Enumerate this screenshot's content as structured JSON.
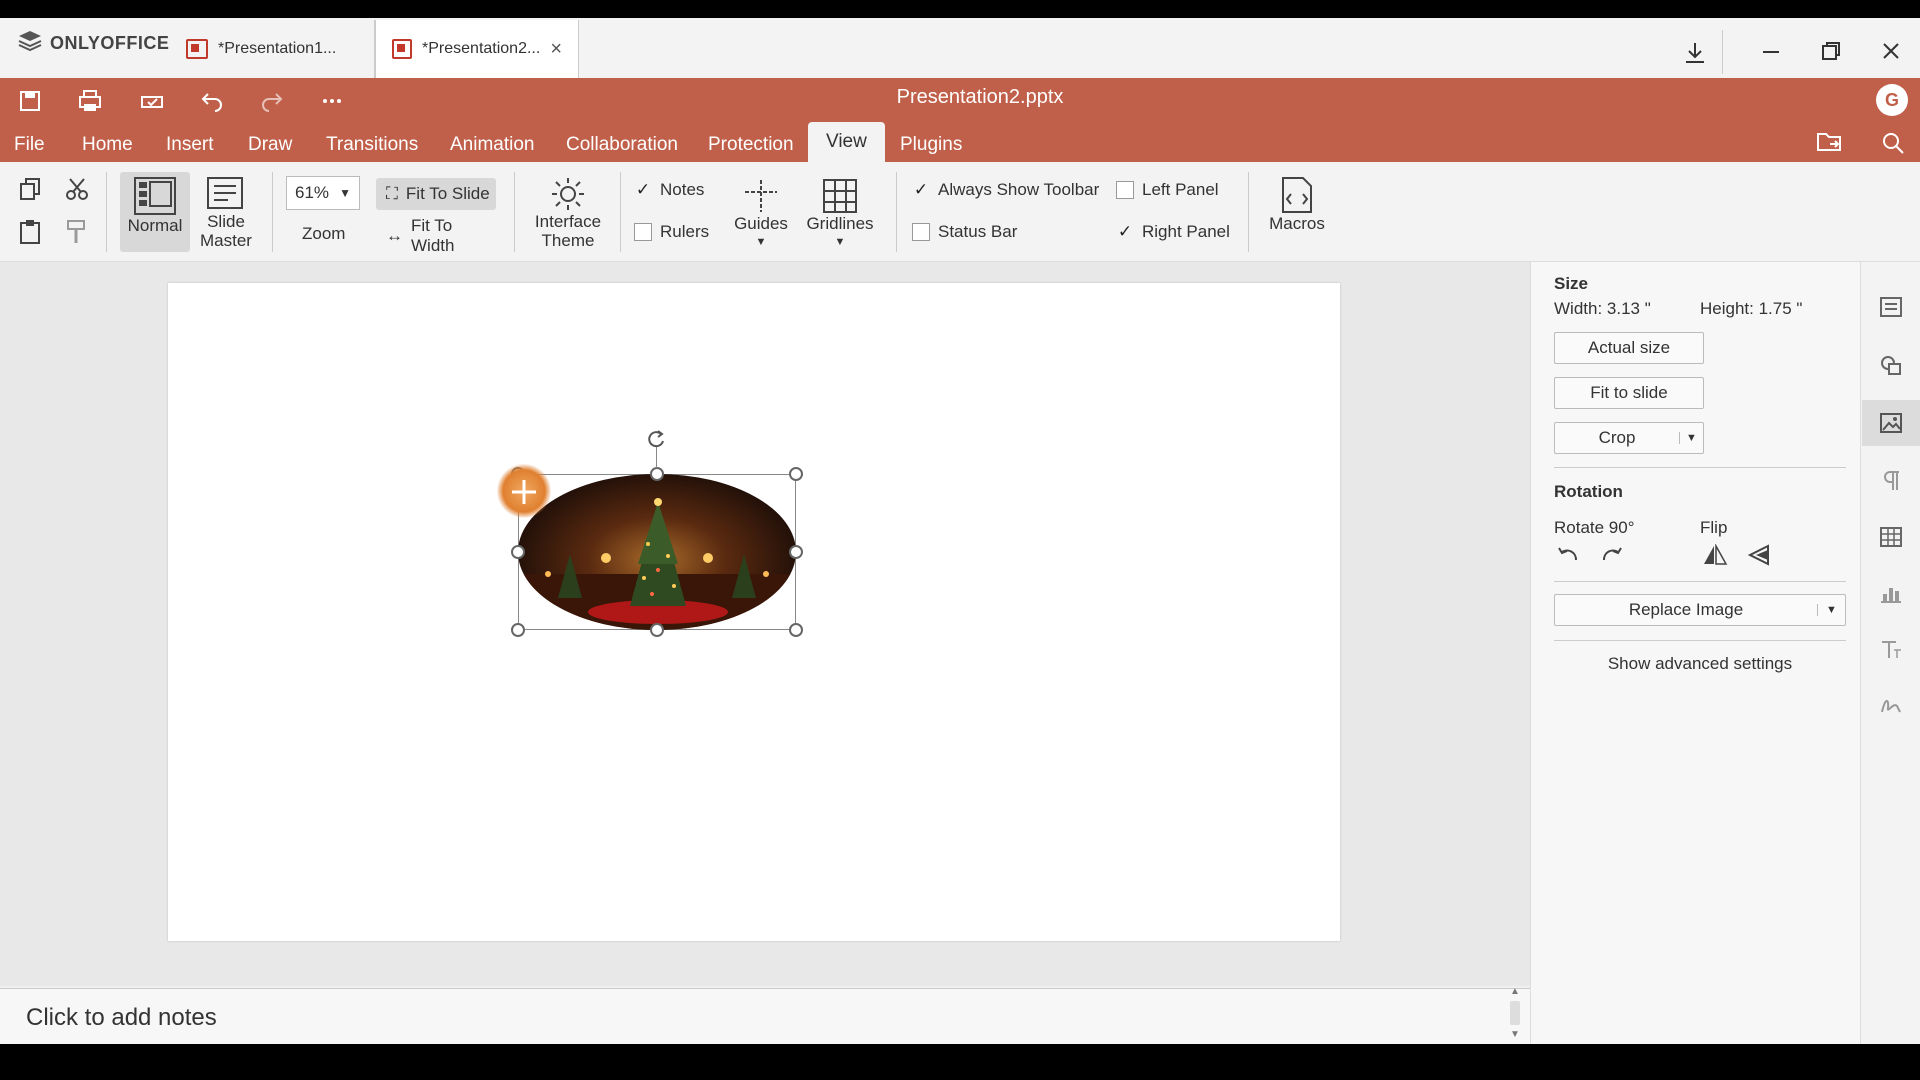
{
  "app": {
    "brand": "ONLYOFFICE",
    "file_title": "Presentation2.pptx",
    "user_initial": "G"
  },
  "tabs": [
    {
      "label": "*Presentation1...",
      "close": ""
    },
    {
      "label": "*Presentation2...",
      "close": "×"
    }
  ],
  "menu": [
    "File",
    "Home",
    "Insert",
    "Draw",
    "Transitions",
    "Animation",
    "Collaboration",
    "Protection",
    "View",
    "Plugins"
  ],
  "ribbon": {
    "normal": "Normal",
    "slide_master": "Slide Master",
    "zoom_value": "61%",
    "zoom_label": "Zoom",
    "fit_to_slide": "Fit To Slide",
    "fit_to_width": "Fit To Width",
    "interface_theme": "Interface Theme",
    "notes": "Notes",
    "rulers": "Rulers",
    "guides": "Guides",
    "gridlines": "Gridlines",
    "always_show_toolbar": "Always Show Toolbar",
    "status_bar": "Status Bar",
    "left_panel": "Left Panel",
    "right_panel": "Right Panel",
    "macros": "Macros",
    "checks": {
      "notes": true,
      "rulers": false,
      "always_show_toolbar": true,
      "status_bar": false,
      "left_panel": false,
      "right_panel": true
    }
  },
  "right_panel": {
    "size_title": "Size",
    "width": "Width: 3.13 \"",
    "height": "Height: 1.75 \"",
    "actual_size": "Actual size",
    "fit_to_slide": "Fit to slide",
    "crop": "Crop",
    "rotation_title": "Rotation",
    "rotate_90": "Rotate 90°",
    "flip": "Flip",
    "replace_image": "Replace Image",
    "advanced": "Show advanced settings"
  },
  "notes": {
    "placeholder": "Click to add notes"
  },
  "colors": {
    "accent": "#c1604a"
  }
}
